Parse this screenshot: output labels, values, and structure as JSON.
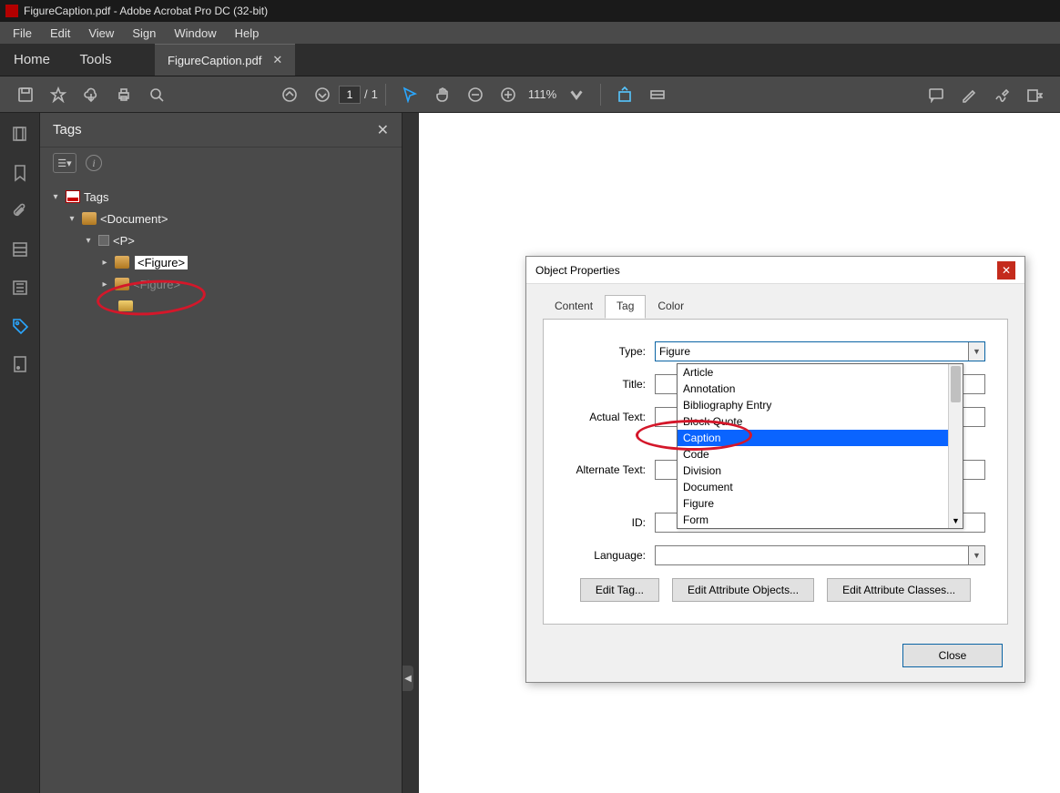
{
  "titlebar": {
    "text": "FigureCaption.pdf - Adobe Acrobat Pro DC (32-bit)"
  },
  "menubar": {
    "items": [
      "File",
      "Edit",
      "View",
      "Sign",
      "Window",
      "Help"
    ]
  },
  "tabs": {
    "home": "Home",
    "tools": "Tools",
    "file": "FigureCaption.pdf"
  },
  "toolbar": {
    "page_current": "1",
    "page_total": "1",
    "page_sep": "/",
    "zoom": "111%"
  },
  "panel": {
    "title": "Tags",
    "root": "Tags",
    "doc": "<Document>",
    "p": "<P>",
    "figure1": "<Figure>",
    "figure2": "<Figure>"
  },
  "dialog": {
    "title": "Object Properties",
    "tabs": {
      "content": "Content",
      "tag": "Tag",
      "color": "Color"
    },
    "labels": {
      "type": "Type:",
      "title": "Title:",
      "actual": "Actual Text:",
      "alt": "Alternate Text:",
      "id": "ID:",
      "lang": "Language:"
    },
    "type_value": "Figure",
    "buttons": {
      "edit_tag": "Edit Tag...",
      "edit_attr_obj": "Edit Attribute Objects...",
      "edit_attr_cls": "Edit Attribute Classes...",
      "close": "Close"
    },
    "dropdown": [
      "Article",
      "Annotation",
      "Bibliography Entry",
      "Block Quote",
      "Caption",
      "Code",
      "Division",
      "Document",
      "Figure",
      "Form"
    ],
    "dropdown_hl_index": 4
  }
}
